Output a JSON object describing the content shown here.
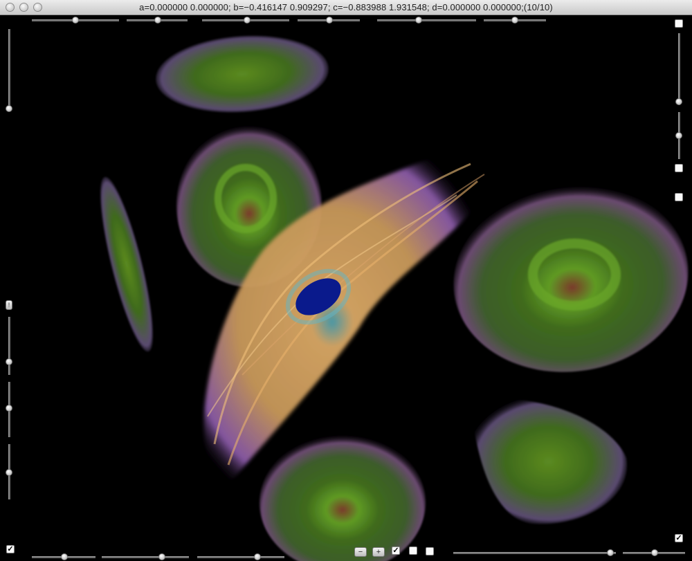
{
  "window": {
    "title": "a=0.000000 0.000000; b=−0.416147 0.909297; c=−0.883988 1.931548; d=0.000000 0.000000;(10/10)"
  },
  "controls": {
    "info_label": "!",
    "minus_label": "−",
    "plus_label": "+",
    "check_mark": "✓",
    "slider_levels": {
      "top_1": 0.5,
      "top_2": 0.5,
      "top_3": 0.5,
      "top_4": 0.5,
      "top_5": 0.5,
      "top_6": 0.5,
      "left_1": 1.0,
      "left_2": 0.5,
      "left_3": 0.5,
      "left_4": 0.5,
      "right_1": 1.0,
      "right_2": 0.5,
      "bottom_1": 0.5,
      "bottom_2": 0.7,
      "bottom_3": 0.7,
      "bottom_4": 0.9,
      "bottom_5": 0.5
    },
    "checkboxes": {
      "top_right": false,
      "right_mid_1": false,
      "right_mid_2": false,
      "bottom_left": true,
      "bottom_center_1": true,
      "bottom_center_2": false,
      "bottom_center_3": false,
      "bottom_right": true
    }
  },
  "colors": {
    "background": "#000000",
    "cytoplasm": "#e8b06a",
    "nucleus": "#0a1a8c",
    "cell_green": "#4c8a1e",
    "halo_purple": "#9b57d0"
  }
}
